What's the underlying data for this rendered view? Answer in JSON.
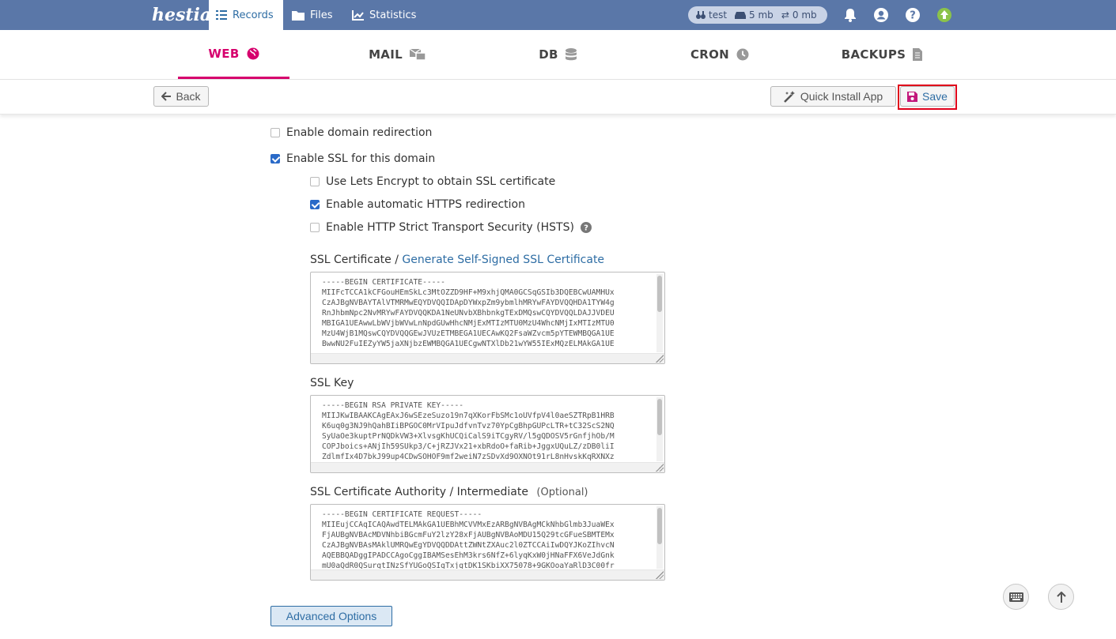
{
  "topbar": {
    "logo": "hestia",
    "nav": [
      {
        "label": "Records",
        "active": true,
        "icon": "list-icon"
      },
      {
        "label": "Files",
        "active": false,
        "icon": "folder-icon"
      },
      {
        "label": "Statistics",
        "active": false,
        "icon": "chart-icon"
      }
    ],
    "usage": {
      "user": "test",
      "disk": "5 mb",
      "bandwidth": "0 mb"
    },
    "colors": {
      "bar": "#5a77a8",
      "active_text": "#2e6da4",
      "update": "#8bc34a"
    }
  },
  "tabs": [
    {
      "label": "WEB",
      "icon": "globe-icon",
      "active": true
    },
    {
      "label": "MAIL",
      "icon": "mail-icon",
      "active": false
    },
    {
      "label": "DB",
      "icon": "database-icon",
      "active": false
    },
    {
      "label": "CRON",
      "icon": "clock-icon",
      "active": false
    },
    {
      "label": "BACKUPS",
      "icon": "file-icon",
      "active": false
    }
  ],
  "toolbar": {
    "back_label": "Back",
    "quick_install_label": "Quick Install App",
    "save_label": "Save"
  },
  "form": {
    "enable_redirection": {
      "label": "Enable domain redirection",
      "checked": false
    },
    "enable_ssl": {
      "label": "Enable SSL for this domain",
      "checked": true
    },
    "lets_encrypt": {
      "label": "Use Lets Encrypt to obtain SSL certificate",
      "checked": false
    },
    "https_redirect": {
      "label": "Enable automatic HTTPS redirection",
      "checked": true
    },
    "hsts": {
      "label": "Enable HTTP Strict Transport Security (HSTS)",
      "checked": false
    },
    "ssl_certificate": {
      "label": "SSL Certificate /",
      "link": "Generate Self-Signed SSL Certificate",
      "value": "-----BEGIN CERTIFICATE-----\nMIIFcTCCA1kCFGouHEmSkLc3MtOZZD9HF+M9xhjQMA0GCSqGSIb3DQEBCwUAMHUx\nCzAJBgNVBAYTAlVTMRMwEQYDVQQIDApDYWxpZm9ybmlhMRYwFAYDVQQHDA1TYW4g\nRnJhbmNpc2NvMRYwFAYDVQQKDA1NeUNvbXBhbnkgTExDMQswCQYDVQQLDAJJVDEU\nMBIGA1UEAwwLbWVjbWVwLnNpdGUwHhcNMjExMTIzMTU0MzU4WhcNMjIxMTIzMTU0\nMzU4WjB1MQswCQYDVQQGEwJVUzETMBEGA1UECAwKQ2FsaWZvcm5pYTEWMBQGA1UE\nBwwNU2FuIEZyYW5jaXNjbzEWMBQGA1UECgwNTXlDb21wYW55IExMQzELMAkGA1UE"
    },
    "ssl_key": {
      "label": "SSL Key",
      "value": "-----BEGIN RSA PRIVATE KEY-----\nMIIJKwIBAAKCAgEAxJ6wSEzeSuzo19n7qXKorFbSMc1oUVfpV4l0aeSZTRpB1HRB\nK6uq0g3NJ9hQahBIiBPGOC0MrVIpuJdfvnTvz70YpCgBhpGUPcLTR+tC32ScS2NQ\nSyUaOe3kuptPrNQDkVW3+XlvsgKhUCQiCalS9iTCgyRV/l5gQDOSV5rGnfjhOb/M\nCOPJboics+ANjIh59SUkp3/C+jRZJVx21+xbRdoO+faRib+JggxUQuLZ/zDB0liI\nZdlmfIx4D7bkJ99up4CDwSOHOF9mf2weiN7zSDvXd9OXNOt91rL8nHvskKqRXNXz"
    },
    "ssl_ca": {
      "label": "SSL Certificate Authority / Intermediate",
      "optional": "(Optional)",
      "value": "-----BEGIN CERTIFICATE REQUEST-----\nMIIEujCCAqICAQAwdTELMAkGA1UEBhMCVVMxEzARBgNVBAgMCkNhbGlmb3JuaWEx\nFjAUBgNVBAcMDVNhbiBGcmFuY2lzY28xFjAUBgNVBAoMDU15Q29tcGFueSBMTEMx\nCzAJBgNVBAsMAklUMRQwEgYDVQQDDAttZWNtZXAuc2l0ZTCCAiIwDQYJKoZIhvcN\nAQEBBQADggIPADCCAgoCggIBAMSesEhM3krs6NfZ+6lyqKxW0jHNaFFX6VeJdGnk\nmU0aQdR0QSurqtINzSfYUGoQSIgTxjgtDK1SKbiXX75078+9GKOoaYaRlD3C00fr"
    },
    "advanced_label": "Advanced Options"
  }
}
